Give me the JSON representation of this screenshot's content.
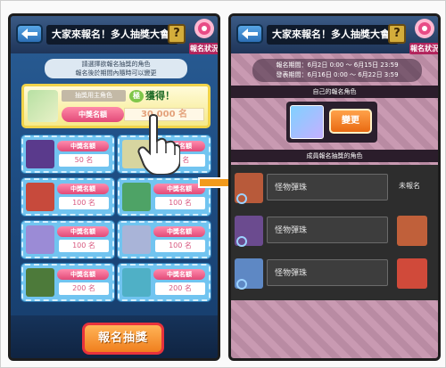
{
  "left": {
    "header": {
      "title": "大家來報名！多人抽獎大會",
      "help_label": "?",
      "status_label": "報名狀況"
    },
    "notice": {
      "line1": "請選擇欲報名抽獎的角色",
      "line2": "報名後於期間內隨時可以變更"
    },
    "featured": {
      "tag": "抽獎用主角色",
      "rank_label": "獲得！",
      "rank_icon": "極",
      "quota_label": "中獎名額",
      "quota_value": "30,000 名"
    },
    "cards": [
      {
        "label": "中獎名額",
        "value": "50 名",
        "color": "#5a3a8c"
      },
      {
        "label": "中獎名額",
        "value": "50 名",
        "color": "#d7d5a0"
      },
      {
        "label": "中獎名額",
        "value": "100 名",
        "color": "#c74a3c"
      },
      {
        "label": "中獎名額",
        "value": "100 名",
        "color": "#4ea366"
      },
      {
        "label": "中獎名額",
        "value": "100 名",
        "color": "#9b8bd6"
      },
      {
        "label": "中獎名額",
        "value": "100 名",
        "color": "#a9b4d8"
      },
      {
        "label": "中獎名額",
        "value": "200 名",
        "color": "#4d7a3a"
      },
      {
        "label": "中獎名額",
        "value": "200 名",
        "color": "#4fb0c6"
      }
    ],
    "enter_button": "報名抽獎"
  },
  "right": {
    "header": {
      "title": "大家來報名！多人抽獎大會",
      "help_label": "?",
      "status_label": "報名狀況"
    },
    "period": {
      "line1": "報名期間：6月2日 0:00 ～ 6月15日 23:59",
      "line2": "發表期間：6月16日 0:00 ～ 6月22日 3:59"
    },
    "own_section_title": "自己的報名角色",
    "change_button": "變更",
    "members_section_title": "成員報名抽獎的角色",
    "members": [
      {
        "name": "怪物彈珠",
        "state": "未報名",
        "portrait_color": "#b85a3a"
      },
      {
        "name": "怪物彈珠",
        "state": "",
        "portrait_color": "#6b4b8f",
        "thumb_color": "#c0603a"
      },
      {
        "name": "怪物彈珠",
        "state": "",
        "portrait_color": "#5e88c4",
        "thumb_color": "#d04a3a"
      }
    ]
  }
}
